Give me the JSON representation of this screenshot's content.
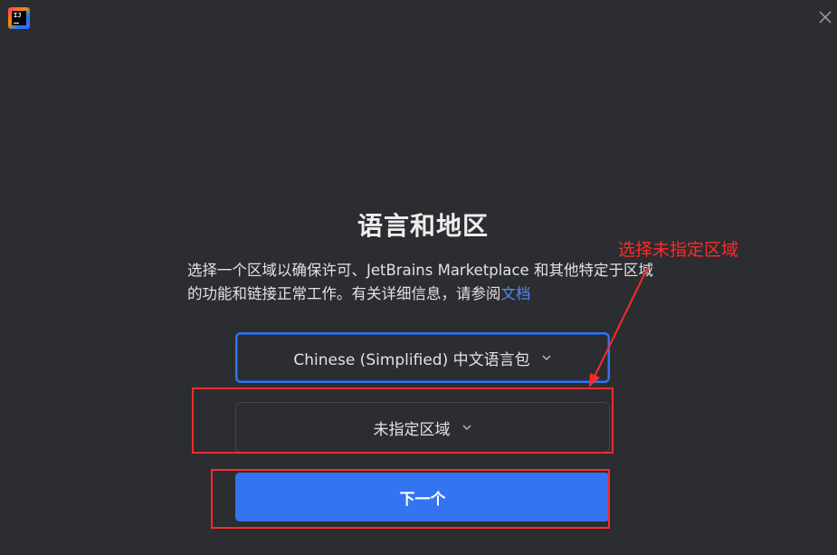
{
  "window": {
    "app_icon": "intellij-logo-icon",
    "app_icon_text": "IJ",
    "close_icon": "close-icon"
  },
  "dialog": {
    "title": "语言和地区",
    "description_text": "选择一个区域以确保许可、JetBrains Marketplace 和其他特定于区域的功能和链接正常工作。有关详细信息，请参阅",
    "description_link": "文档",
    "language_select": {
      "value": "Chinese (Simplified) 中文语言包"
    },
    "region_select": {
      "value": "未指定区域"
    },
    "next_button": "下一个"
  },
  "annotation": {
    "text": "选择未指定区域",
    "color": "#ff2a2a"
  },
  "colors": {
    "background": "#2b2d30",
    "accent": "#3574f0",
    "link": "#548af7"
  }
}
